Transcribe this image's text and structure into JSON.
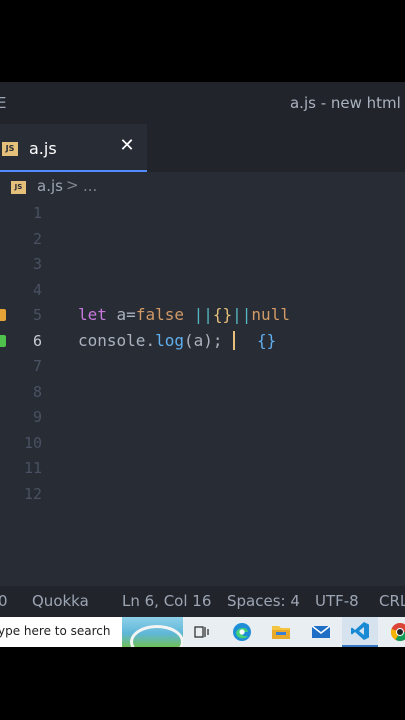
{
  "titlebar": {
    "menu_fragment": "E",
    "title": "a.js - new html -"
  },
  "tab": {
    "badge": "JS",
    "label": "a.js",
    "close": "✕"
  },
  "breadcrumb": {
    "badge": "JS",
    "file": "a.js",
    "separator": ">",
    "more": "..."
  },
  "editor": {
    "line_numbers": [
      "1",
      "2",
      "3",
      "4",
      "5",
      "6",
      "7",
      "8",
      "9",
      "10",
      "11",
      "12"
    ],
    "active_line": "6",
    "line5": {
      "kw": "let",
      "rest1": " a=",
      "val_false": "false",
      "sp": " ",
      "or1": "||",
      "braces": "{}",
      "or2": "||",
      "val_null": "null"
    },
    "line6": {
      "obj": "console",
      "dot": ".",
      "method": "log",
      "args": "(a);"
    },
    "hint": "{}",
    "markers": {
      "line5": "#e5a536",
      "line6": "#4ec24a"
    }
  },
  "statusbar": {
    "zero": "0",
    "quokka": "Quokka",
    "position": "Ln 6, Col 16",
    "spaces": "Spaces: 4",
    "encoding": "UTF-8",
    "eol": "CRL"
  },
  "taskbar": {
    "search_placeholder": "ype here to search",
    "icons": [
      "task-view-icon",
      "edge-icon",
      "file-explorer-icon",
      "mail-icon",
      "vscode-icon",
      "chrome-icon"
    ]
  }
}
